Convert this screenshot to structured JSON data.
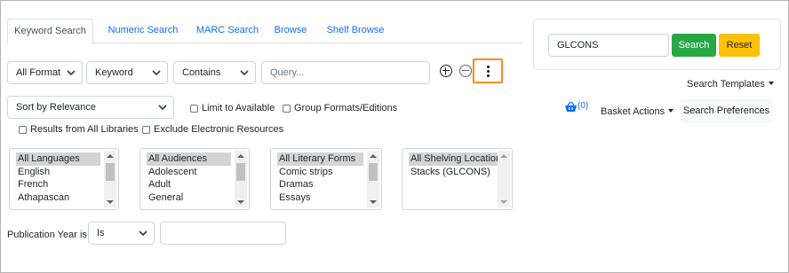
{
  "tabs": [
    {
      "label": "Keyword Search",
      "active": true
    },
    {
      "label": "Numeric Search",
      "active": false
    },
    {
      "label": "MARC Search",
      "active": false
    },
    {
      "label": "Browse",
      "active": false
    },
    {
      "label": "Shelf Browse",
      "active": false
    }
  ],
  "query_row": {
    "format": "All Formats",
    "field": "Keyword",
    "operator": "Contains",
    "query_placeholder": "Query..."
  },
  "sort": {
    "value": "Sort by Relevance"
  },
  "checkboxes": {
    "limit_available": "Limit to Available",
    "group_formats": "Group Formats/Editions",
    "all_libraries": "Results from All Libraries",
    "exclude_electronic": "Exclude Electronic Resources"
  },
  "filters": {
    "languages": [
      "All Languages",
      "English",
      "French",
      "Athapascan"
    ],
    "audiences": [
      "All Audiences",
      "Adolescent",
      "Adult",
      "General"
    ],
    "literary_forms": [
      "All Literary Forms",
      "Comic strips",
      "Dramas",
      "Essays"
    ],
    "shelving": [
      "All Shelving Locations",
      "Stacks (GLCONS)"
    ]
  },
  "pub_year": {
    "label": "Publication Year is",
    "operator": "Is",
    "value": ""
  },
  "catalog_search": {
    "value": "GLCONS",
    "search_label": "Search",
    "reset_label": "Reset"
  },
  "actions": {
    "templates": "Search Templates",
    "basket_count": "(0)",
    "basket_actions": "Basket Actions",
    "preferences": "Search Preferences"
  },
  "colors": {
    "primary": "#0d6efd",
    "search": "#28a745",
    "reset": "#ffc107",
    "highlight": "#f0912a"
  }
}
